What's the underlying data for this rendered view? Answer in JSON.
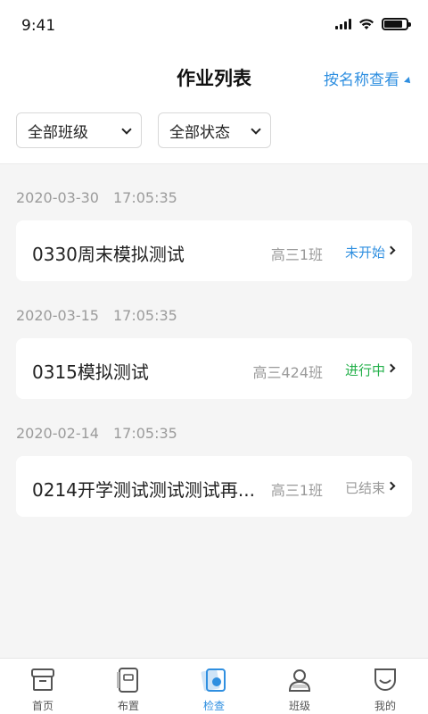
{
  "status_bar": {
    "time": "9:41",
    "battery_level": 0.85
  },
  "header": {
    "title": "作业列表",
    "sort_action": "按名称查看"
  },
  "filters": {
    "class_filter": "全部班级",
    "status_filter": "全部状态"
  },
  "groups": [
    {
      "date": "2020-03-30",
      "time": "17:05:35",
      "item": {
        "title": "0330周末模拟测试",
        "class": "高三1班",
        "status": "未开始",
        "status_color": "#2f8fe0"
      }
    },
    {
      "date": "2020-03-15",
      "time": "17:05:35",
      "item": {
        "title": "0315模拟测试",
        "class": "高三424班",
        "status": "进行中",
        "status_color": "#23b04a"
      }
    },
    {
      "date": "2020-02-14",
      "time": "17:05:35",
      "item": {
        "title": "0214开学测试测试测试再...",
        "class": "高三1班",
        "status": "已结束",
        "status_color": "#9a9a9a"
      }
    }
  ],
  "tabs": [
    {
      "label": "首页",
      "icon": "home-icon",
      "active": false
    },
    {
      "label": "布置",
      "icon": "assign-icon",
      "active": false
    },
    {
      "label": "检查",
      "icon": "check-icon",
      "active": true
    },
    {
      "label": "班级",
      "icon": "class-icon",
      "active": false
    },
    {
      "label": "我的",
      "icon": "profile-icon",
      "active": false
    }
  ],
  "colors": {
    "accent": "#2f8fe0",
    "background": "#f5f5f5"
  }
}
